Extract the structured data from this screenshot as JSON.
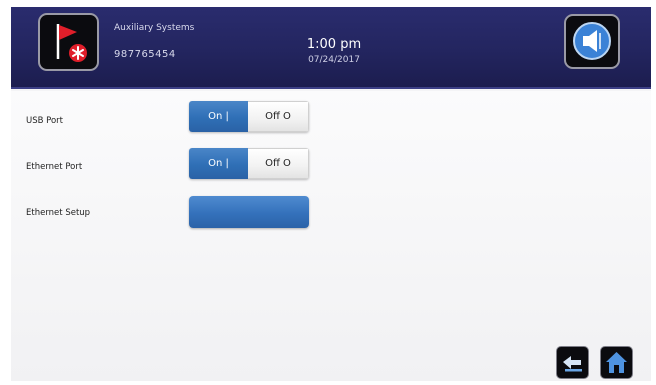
{
  "header": {
    "system_name": "Auxiliary Systems",
    "unit_id": "987765454",
    "time": "1:00 pm",
    "date": "07/24/2017",
    "app_icon": "flag-alarm-icon",
    "sound_icon": "speaker-icon"
  },
  "settings": [
    {
      "label": "USB Port",
      "on_label": "On  |",
      "off_label": "Off  O",
      "state": "On"
    },
    {
      "label": "Ethernet Port",
      "on_label": "On  |",
      "off_label": "Off  O",
      "state": "On"
    },
    {
      "label": "Ethernet Setup"
    }
  ],
  "footer": {
    "back_icon": "back-arrow-icon",
    "home_icon": "home-icon"
  },
  "colors": {
    "header_bg": "#23255f",
    "toggle_on": "#2f6fb6",
    "flag_red": "#e01e2a"
  }
}
